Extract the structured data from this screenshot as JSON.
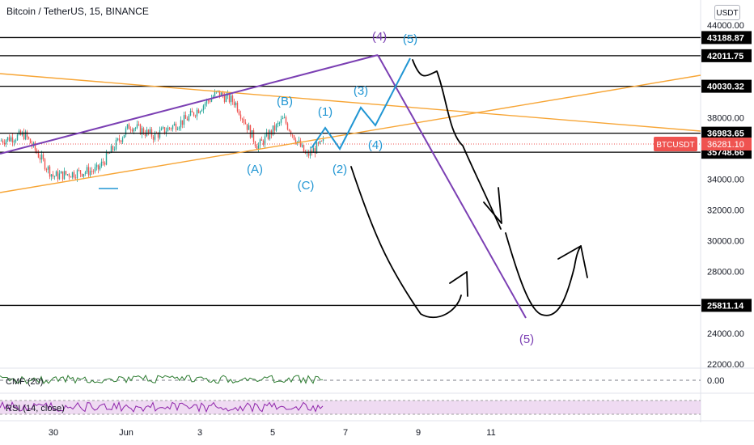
{
  "header": {
    "symbol_title": "Bitcoin / TetherUS, 15, BINANCE",
    "currency_badge": "USDT"
  },
  "colors": {
    "bull_candle": "#26a69a",
    "bear_candle": "#ef5350",
    "channel_purple": "#7b3fb3",
    "fib_orange": "#f7a535",
    "wave_blue": "#2196d3",
    "price_tag": "#ef5350",
    "level_line": "#000000",
    "cmf_green": "#2e7d32",
    "rsi_purple": "#8e24aa",
    "rsi_band": "#e1bee7"
  },
  "chart_data": {
    "type": "candlestick",
    "price_axis": {
      "ylim": [
        21600,
        44400
      ],
      "ticks": [
        "44000.00",
        "42000.00",
        "40000.00",
        "38000.00",
        "36000.00",
        "34000.00",
        "32000.00",
        "30000.00",
        "28000.00",
        "26000.00",
        "24000.00",
        "22000.00"
      ]
    },
    "time_axis": {
      "ticks": [
        "30",
        "Jun",
        "3",
        "5",
        "7",
        "9",
        "11"
      ]
    },
    "price_range_of_candles": [
      33400,
      39800
    ],
    "horizontal_levels": [
      {
        "value": 43188.87,
        "label": "43188.87"
      },
      {
        "value": 42011.75,
        "label": "42011.75"
      },
      {
        "value": 40030.32,
        "label": "40030.32"
      },
      {
        "value": 36983.65,
        "label": "36983.65"
      },
      {
        "value": 35748.66,
        "label": "35748.66"
      },
      {
        "value": 25811.14,
        "label": "25811.14"
      }
    ],
    "current_price": {
      "symbol": "BTCUSDT",
      "value": 36281.1,
      "label": "36281.10"
    },
    "wave_labels_blue": [
      "(1)",
      "(2)",
      "(3)",
      "(4)",
      "(5)",
      "(4)",
      "(A)",
      "(B)",
      "(C)"
    ],
    "wave_labels_purple": [
      "(4)",
      "(5)"
    ],
    "indicators": [
      {
        "name": "CMF (20)",
        "label": "CMF (20)",
        "value_label": "0.00"
      },
      {
        "name": "RSI (14, close)",
        "label": "RSI (14, close)"
      }
    ]
  }
}
